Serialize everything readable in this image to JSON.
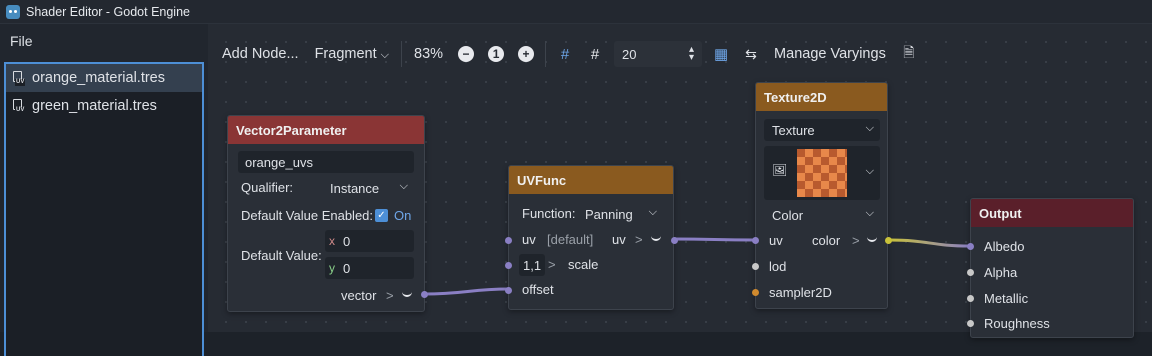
{
  "window": {
    "title": "Shader Editor - Godot Engine"
  },
  "left_panel": {
    "file_menu": "File",
    "files": [
      {
        "name": "orange_material.tres",
        "selected": true
      },
      {
        "name": "green_material.tres",
        "selected": false
      }
    ]
  },
  "toolbar": {
    "add_node": "Add Node...",
    "mode": "Fragment",
    "zoom": "83%",
    "zoom_out_icon": "minus-icon",
    "zoom_reset_label": "1",
    "zoom_in_icon": "plus-icon",
    "snap_distance": "20",
    "manage_varyings": "Manage Varyings"
  },
  "nodes": {
    "vector2param": {
      "title": "Vector2Parameter",
      "name_value": "orange_uvs",
      "qualifier_label": "Qualifier:",
      "qualifier_value": "Instance",
      "default_enabled_label": "Default Value Enabled:",
      "default_enabled_value": "On",
      "default_value_label": "Default Value:",
      "x_label": "x",
      "x_value": "0",
      "y_label": "y",
      "y_value": "0",
      "output_label": "vector",
      "arrow": ">"
    },
    "uvfunc": {
      "title": "UVFunc",
      "function_label": "Function:",
      "function_value": "Panning",
      "uv_label": "uv",
      "uv_default": "[default]",
      "uv_output": "uv",
      "scale_value": "1,1",
      "scale_label": "scale",
      "offset_label": "offset",
      "arrow": ">"
    },
    "texture2d": {
      "title": "Texture2D",
      "source_value": "Texture",
      "type_value": "Color",
      "uv_label": "uv",
      "color_output": "color",
      "lod_label": "lod",
      "sampler_label": "sampler2D",
      "arrow": ">"
    },
    "output": {
      "title": "Output",
      "ports": [
        "Albedo",
        "Alpha",
        "Metallic",
        "Roughness"
      ]
    }
  },
  "colors": {
    "vector2param_header": "#8a3535",
    "uvfunc_header": "#8a5a1f",
    "texture2d_header": "#8a5a1f",
    "output_header": "#5a1f2a",
    "vector_port": "#8a7fc4",
    "sampler_port": "#d08a2e",
    "color_port": "#c9c23a",
    "accent": "#4d8fd6"
  }
}
